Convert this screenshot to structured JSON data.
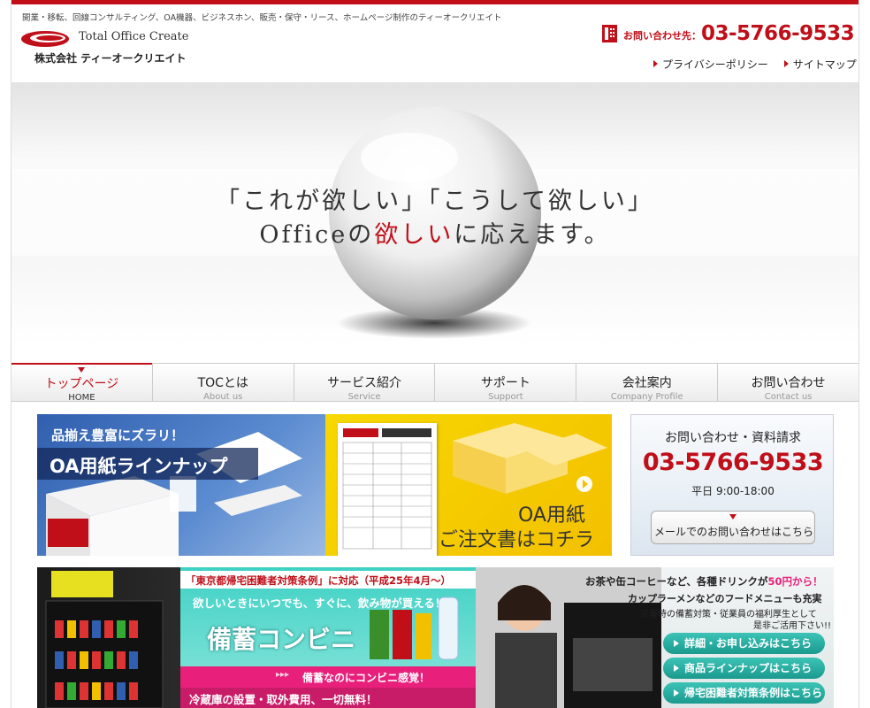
{
  "header": {
    "tagline": "開業・移転、回線コンサルティング、OA機器、ビジネスホン、販売・保守・リース、ホームページ制作のティーオークリエイト",
    "logo_en": "Total Office Create",
    "logo_jp": "株式会社 ティーオークリエイト",
    "contact_label": "お問い合わせ先：",
    "contact_number": "03-5766-9533",
    "links": [
      "プライバシーポリシー",
      "サイトマップ"
    ]
  },
  "hero": {
    "line1": "「これが欲しい」「こうして欲しい」",
    "line2_before": "Officeの",
    "line2_highlight": "欲しい",
    "line2_after": "に応えます。"
  },
  "nav": {
    "items": [
      {
        "jp": "トップページ",
        "en": "HOME"
      },
      {
        "jp": "TOCとは",
        "en": "About us"
      },
      {
        "jp": "サービス紹介",
        "en": "Service"
      },
      {
        "jp": "サポート",
        "en": "Support"
      },
      {
        "jp": "会社案内",
        "en": "Company Profile"
      },
      {
        "jp": "お問い合わせ",
        "en": "Contact us"
      }
    ]
  },
  "banner_paper": {
    "top": "品揃え豊富にズラリ！",
    "title": "OA用紙ラインナップ"
  },
  "banner_order": {
    "line1": "OA用紙",
    "line2": "ご注文書はコチラ"
  },
  "side_contact": {
    "title": "お問い合わせ・資料請求",
    "number": "03-5766-9533",
    "hours": "平日 9:00-18:00",
    "button": "メールでのお問い合わせはこちら"
  },
  "bichiku": {
    "notice": "「東京都帰宅困難者対策条例」に対応（平成25年4月～）",
    "sub": "欲しいときにいつでも、すぐに、飲み物が買える！",
    "title": "備蓄コンビニ",
    "pink_arrow": "▸▸▸",
    "pink": "備蓄なのにコンビニ感覚！",
    "bottom": "冷蔵庫の設置・取外費用、一切無料！",
    "r1_before": "お茶や缶コーヒーなど、各種ドリンクが",
    "r1_red": "50円から！",
    "r2": "カップラーメンなどのフードメニューも充実",
    "r3": "災害時の備蓄対策・従業員の福利厚生として",
    "r4": "是非ご活用下さい!!",
    "buttons": [
      "詳細・お申し込みはこちら",
      "商品ラインナップはこちら",
      "帰宅困難者対策条例はこちら"
    ]
  },
  "colors": {
    "brand_red": "#c00f19",
    "pink": "#e8207c",
    "teal": "#1b9a8f",
    "yellow": "#f3c000",
    "blue": "#2f5fae"
  }
}
